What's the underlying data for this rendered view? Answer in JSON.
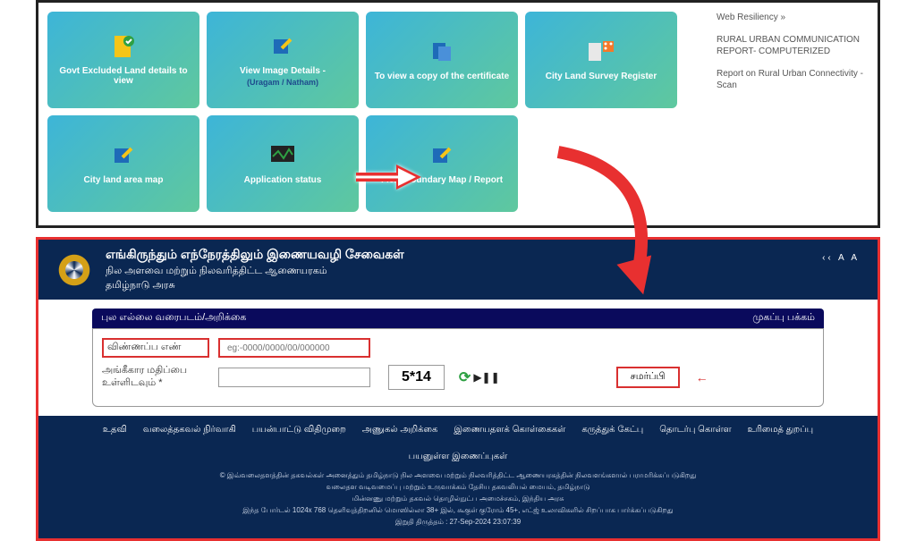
{
  "tiles": [
    {
      "label": "Govt Excluded Land details to view",
      "sub": ""
    },
    {
      "label": "View Image Details -",
      "sub": "(Uragam / Natham)"
    },
    {
      "label": "To view a copy of the certificate",
      "sub": ""
    },
    {
      "label": "City Land Survey Register",
      "sub": ""
    },
    {
      "label": "City land area map",
      "sub": ""
    },
    {
      "label": "Application status",
      "sub": ""
    },
    {
      "label": "Field Boundary Map / Report",
      "sub": ""
    }
  ],
  "sidebar": [
    "Web Resiliency »",
    "RURAL URBAN COMMUNICATION REPORT- COMPUTERIZED",
    "Report on Rural Urban Connectivity - Scan"
  ],
  "gov": {
    "title": "எங்கிருந்தும் எந்நேரத்திலும் இணையவழி சேவைகள்",
    "subtitle1": "நில அளவை மற்றும் நிலவரித்திட்ட ஆணையரகம்",
    "subtitle2": "தமிழ்நாடு அரசு",
    "font_controls": "‹‹ A A"
  },
  "form": {
    "bar_left": "புல எல்லை வரைபடம்/அறிக்கை",
    "bar_right": "முகப்பு பக்கம்",
    "app_no_label": "விண்ணப்ப எண்",
    "app_no_placeholder": "eg:-0000/0000/00/000000",
    "captcha_label": "அங்கீகார மதிப்பை உள்ளிடவும் *",
    "captcha_text": "5*14",
    "submit": "சமர்ப்பி"
  },
  "footer": {
    "links": [
      "உதவி",
      "வலைத்தகவல் நிர்வாகி",
      "பயன்பாட்டு விதிமுறை",
      "அணுகல் அறிக்கை",
      "இணையதளக் கொள்கைகள்",
      "கருத்துக் கேட்பு",
      "தொடர்பு கொள்ள",
      "உரிமைத் துறப்பு",
      "பயனுள்ள இணைப்புகள்"
    ],
    "line1": "© இவ்வலைதளத்தின் தகவல்கள் அனைத்தும் தமிழ்நாடு நில அளவை மற்றும் நிலவரித்திட்ட ஆணையரகத்தின் நிலவளங்களால் பராமரிக்கப்படுகிறது",
    "line2": "வலைதள வடிவமைப்பு மற்றும் உருவாக்கம் தேசிய தகவலியல் மையம், தமிழ்நாடு",
    "line3": "மின்னணு மற்றும் தகவல் தொழில்நுட்ப அமைச்சகம், இந்திய அரசு",
    "line4": "இந்த போர்டல் 1024x 768 தெளிவுத்திறனில் மொஸில்லா 38+ இல், கூகுள் குரோம் 45+, எட்ஜ் உலாவிகளில் சிறப்பாக பார்க்கப்படுகிறது",
    "line5": "இறுதி திருத்தம் : 27-Sep-2024 23:07:39"
  }
}
